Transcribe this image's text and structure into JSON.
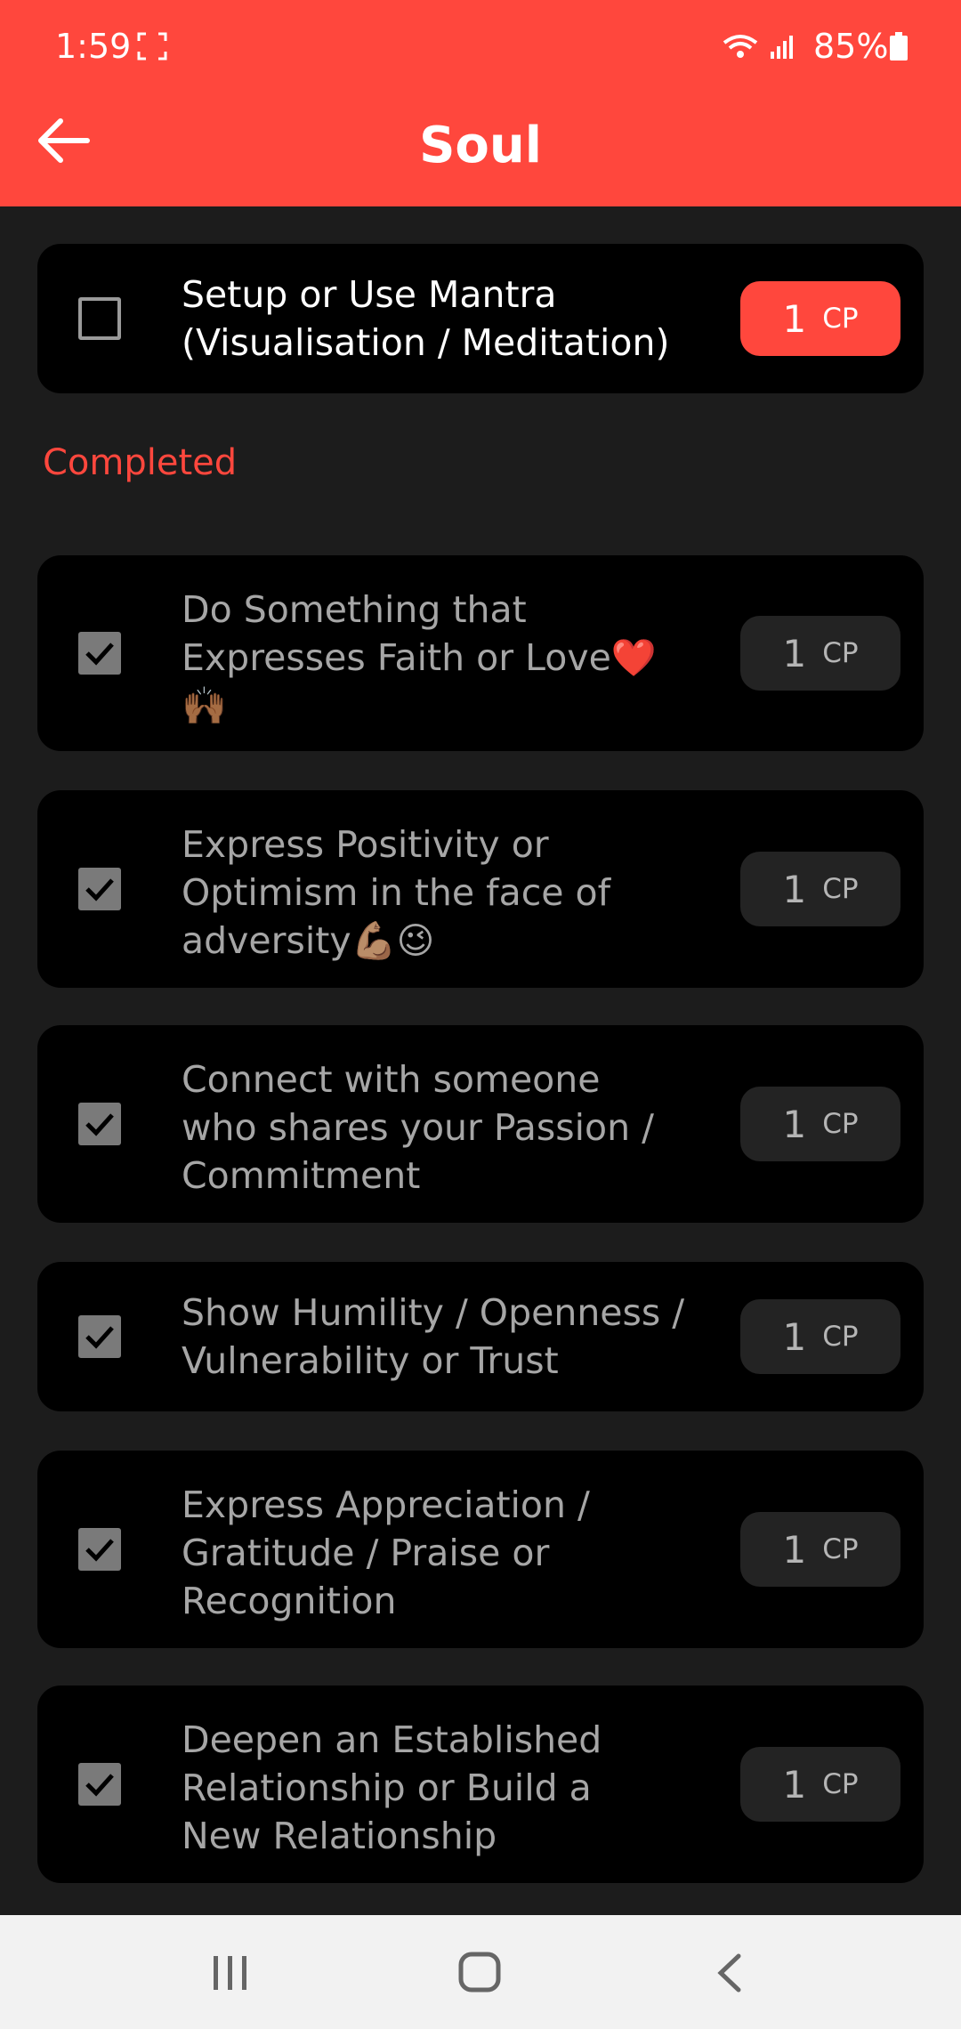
{
  "status_bar": {
    "time": "1:59",
    "battery": "85%"
  },
  "header": {
    "title": "Soul"
  },
  "pending_tasks": [
    {
      "text": "Setup or Use Mantra\n(Visualisation / Meditation)",
      "points": "1",
      "unit": "CP",
      "checked": false
    }
  ],
  "section_completed_label": "Completed",
  "completed_tasks": [
    {
      "text": "Do Something that\nExpresses Faith or Love❤️\n🙌🏾",
      "points": "1",
      "unit": "CP",
      "checked": true
    },
    {
      "text": "Express Positivity or\nOptimism in the face of\nadversity💪🏽😉",
      "points": "1",
      "unit": "CP",
      "checked": true
    },
    {
      "text": "Connect with someone\nwho shares your Passion /\nCommitment",
      "points": "1",
      "unit": "CP",
      "checked": true
    },
    {
      "text": "Show Humility / Openness /\nVulnerability or Trust",
      "points": "1",
      "unit": "CP",
      "checked": true
    },
    {
      "text": "Express Appreciation /\nGratitude / Praise or\nRecognition",
      "points": "1",
      "unit": "CP",
      "checked": true
    },
    {
      "text": "Deepen an Established\nRelationship or Build a\nNew Relationship",
      "points": "1",
      "unit": "CP",
      "checked": true
    }
  ],
  "colors": {
    "accent": "#ff473d",
    "background": "#1c1c1c",
    "card": "#000000"
  }
}
